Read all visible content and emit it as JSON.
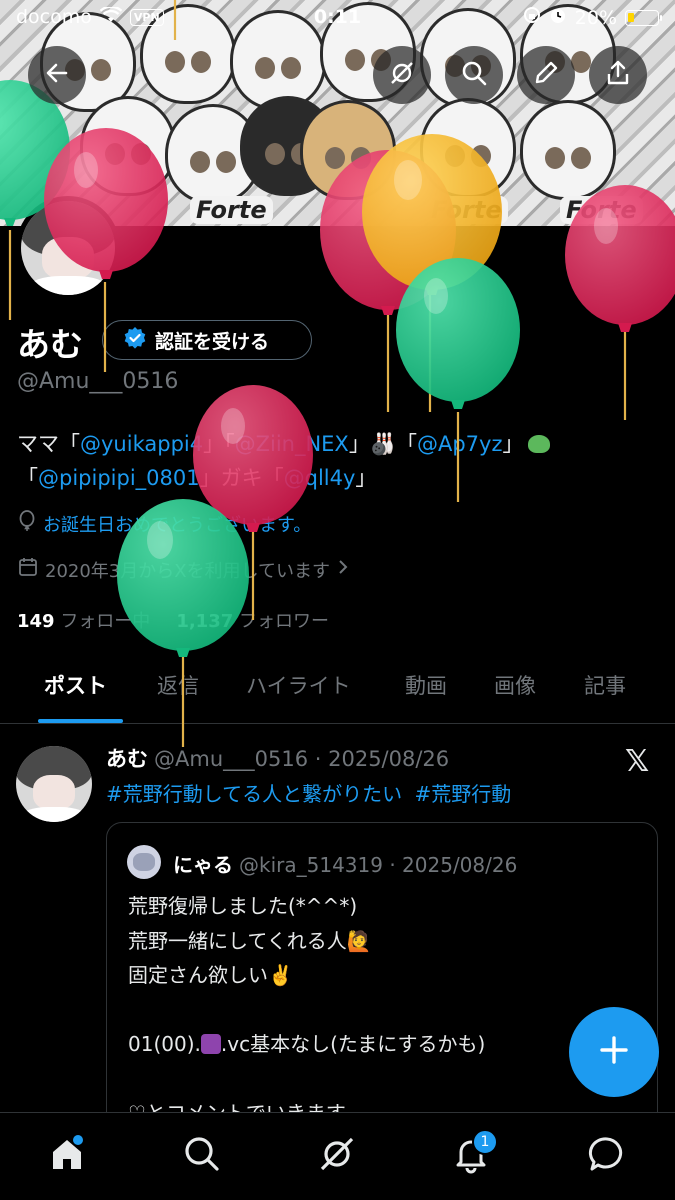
{
  "status_bar": {
    "carrier": "docomo",
    "vpn": "VPN",
    "time": "0:11",
    "battery": "20%"
  },
  "banner": {
    "text": "Forte"
  },
  "profile": {
    "name": "あむ",
    "verify_button": "認証を受ける",
    "handle": "@Amu___0516",
    "bio": {
      "line1_prefix": "ママ「",
      "mention1": "@yuikappi4",
      "line1_mid": "」",
      "mention2": "@Ziin_NEX",
      "line1_mid2": "」🎳「",
      "mention3": "@Ap7yz",
      "line1_suffix": "」",
      "line2_prefix": "「",
      "mention4": "@pipipipi_0801",
      "line2_mid": "」ガキ「",
      "mention5": "@qll4y",
      "line2_suffix": "」"
    },
    "birthday_text": "お誕生日おめでとうございます。",
    "joined_text": "2020年3月からXを利用しています",
    "following_count": "149",
    "following_label": "フォロー中",
    "followers_count": "1,137",
    "followers_label": "フォロワー"
  },
  "tabs": [
    "ポスト",
    "返信",
    "ハイライト",
    "動画",
    "画像",
    "記事"
  ],
  "post": {
    "author": "あむ",
    "handle": "@Amu___0516",
    "date": "· 2025/08/26",
    "hashtags": "#荒野行動してる人と繋がりたい #荒野行動",
    "quote": {
      "author": "にゃる",
      "handle": "@kira_514319",
      "date": "· 2025/08/26",
      "line1": "荒野復帰しました(*^^*)",
      "line2": "荒野一緒にしてくれる人🙋",
      "line3": "固定さん欲しい✌️",
      "line4_prefix": "01(00).",
      "line4_suffix": ".vc基本なし(たまにするかも)",
      "line5": "♡とコメントでいきます"
    }
  },
  "bottom_nav": {
    "notifications_badge": "1"
  },
  "colors": {
    "accent": "#1d9bf0",
    "background": "#000000",
    "secondary_text": "#71767b",
    "balloon_red": "#e0245e",
    "balloon_green": "#1fcf8f",
    "balloon_yellow": "#f5b324"
  },
  "icons": [
    "back-arrow-icon",
    "grok-icon",
    "search-icon",
    "edit-icon",
    "share-icon",
    "verified-badge-icon",
    "balloon-icon",
    "calendar-icon",
    "x-logo-icon",
    "plus-icon",
    "home-icon",
    "notifications-icon",
    "messages-icon"
  ]
}
